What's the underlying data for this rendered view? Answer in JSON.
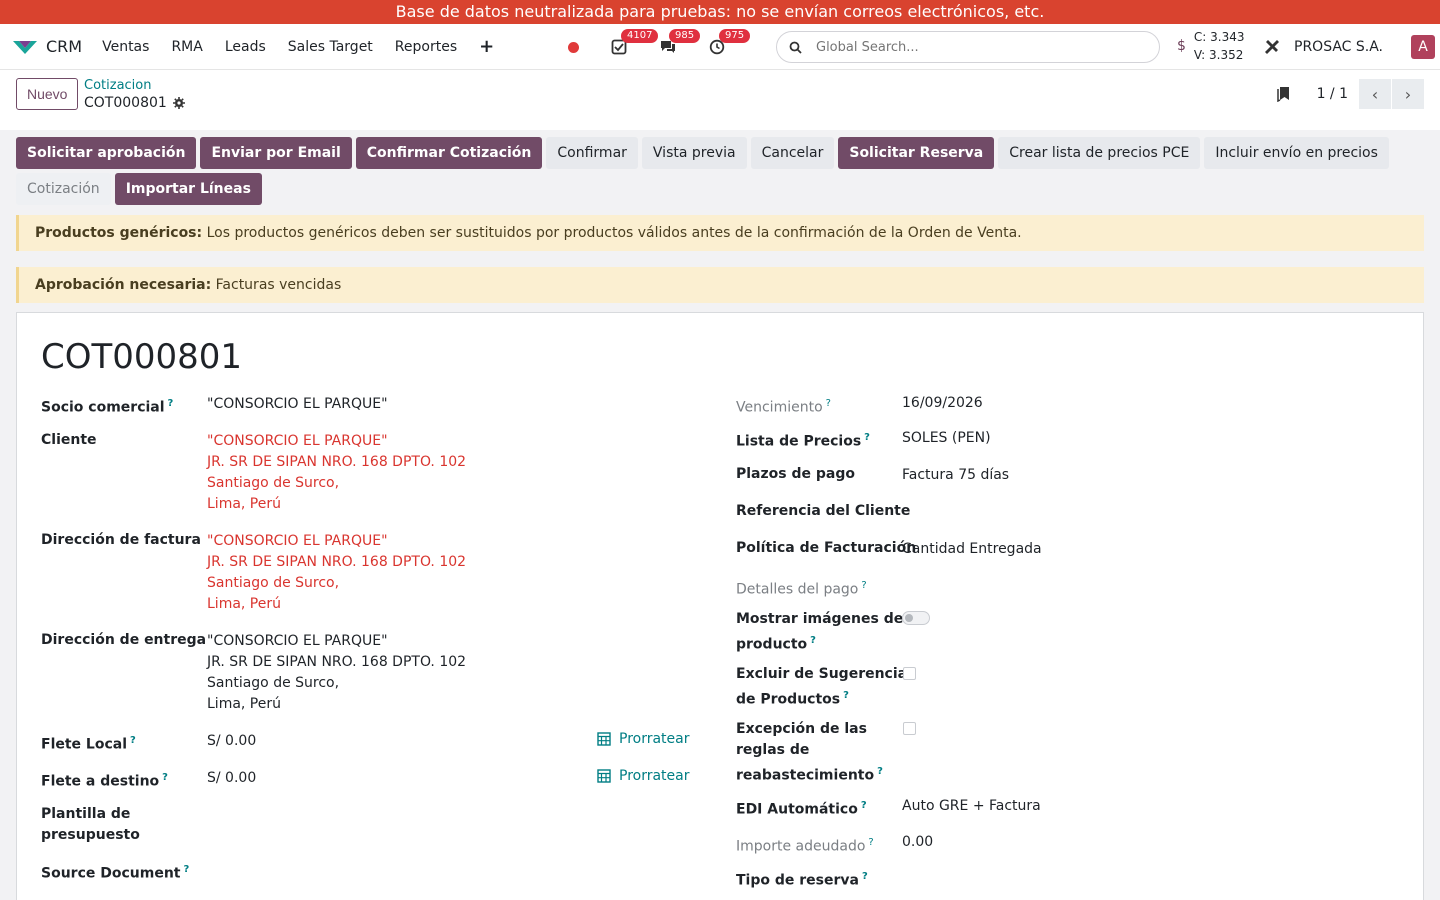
{
  "banner": "Base de datos neutralizada para pruebas: no se envían correos electrónicos, etc.",
  "nav": {
    "app_name": "CRM",
    "menu": [
      "Ventas",
      "RMA",
      "Leads",
      "Sales Target",
      "Reportes"
    ],
    "badges": {
      "activities": "4107",
      "messages": "985",
      "timers": "975"
    },
    "search_placeholder": "Global Search...",
    "rate_c": "C: 3.343",
    "rate_v": "V: 3.352",
    "company": "PROSAC S.A.",
    "avatar_letter": "A"
  },
  "control": {
    "new_label": "Nuevo",
    "breadcrumb_parent": "Cotizacion",
    "breadcrumb_current": "COT000801",
    "pager": "1 / 1"
  },
  "actions": [
    {
      "label": "Solicitar aprobación",
      "style": "primary"
    },
    {
      "label": "Enviar por Email",
      "style": "primary"
    },
    {
      "label": "Confirmar Cotización",
      "style": "primary"
    },
    {
      "label": "Confirmar",
      "style": "secondary"
    },
    {
      "label": "Vista previa",
      "style": "secondary"
    },
    {
      "label": "Cancelar",
      "style": "secondary"
    },
    {
      "label": "Solicitar Reserva",
      "style": "primary"
    },
    {
      "label": "Crear lista de precios PCE",
      "style": "secondary"
    },
    {
      "label": "Incluir envío en precios",
      "style": "secondary"
    },
    {
      "label": "Cotización",
      "style": "status"
    },
    {
      "label": "Importar Líneas",
      "style": "primary"
    }
  ],
  "alerts": [
    {
      "title": "Productos genéricos:",
      "text": " Los productos genéricos deben ser sustituidos por productos válidos antes de la confirmación de la Orden de Venta."
    },
    {
      "title": "Aprobación necesaria:",
      "text": " Facturas vencidas"
    }
  ],
  "form": {
    "title": "COT000801",
    "left": {
      "socio_label": "Socio comercial",
      "socio_value": "\"CONSORCIO EL PARQUE\"",
      "cliente_label": "Cliente",
      "cliente_lines": [
        "\"CONSORCIO EL PARQUE\"",
        "JR. SR DE SIPAN NRO. 168 DPTO. 102",
        "Santiago de Surco,",
        "Lima, Perú"
      ],
      "factura_label": "Dirección de factura",
      "factura_lines": [
        "\"CONSORCIO EL PARQUE\"",
        "JR. SR DE SIPAN NRO. 168 DPTO. 102",
        "Santiago de Surco,",
        "Lima, Perú"
      ],
      "entrega_label": "Dirección de entrega",
      "entrega_lines": [
        "\"CONSORCIO EL PARQUE\"",
        "JR. SR DE SIPAN NRO. 168 DPTO. 102",
        "Santiago de Surco,",
        "Lima, Perú"
      ],
      "flete_local_label": "Flete Local",
      "flete_local_value": "S/ 0.00",
      "flete_destino_label": "Flete a destino",
      "flete_destino_value": "S/ 0.00",
      "prorratear": "Prorratear",
      "plantilla_label_1": "Plantilla de",
      "plantilla_label_2": "presupuesto",
      "source_label": "Source Document"
    },
    "right": {
      "vencimiento_label": "Vencimiento",
      "vencimiento_value": "16/09/2026",
      "lista_label": "Lista de Precios",
      "lista_value": "SOLES (PEN)",
      "plazos_label": "Plazos de pago",
      "plazos_value": "Factura 75 días",
      "referencia_label": "Referencia del Cliente",
      "politica_label": "Política de Facturación",
      "politica_value": "Cantidad Entregada",
      "detalles_label": "Detalles del pago",
      "mostrar_label_1": "Mostrar imágenes de",
      "mostrar_label_2": "producto",
      "excluir_label_1": "Excluir de Sugerencias",
      "excluir_label_2": "de Productos",
      "excepcion_label_1": "Excepción de las",
      "excepcion_label_2": "reglas de",
      "excepcion_label_3": "reabastecimiento",
      "edi_label": "EDI Automático",
      "edi_value": "Auto GRE + Factura",
      "importe_label": "Importe adeudado",
      "importe_value": "0.00",
      "tipo_label": "Tipo de reserva"
    }
  },
  "colors": {
    "primary": "#714B67",
    "teal": "#017e84",
    "banner": "#d9432f",
    "red_text": "#d9352f"
  }
}
